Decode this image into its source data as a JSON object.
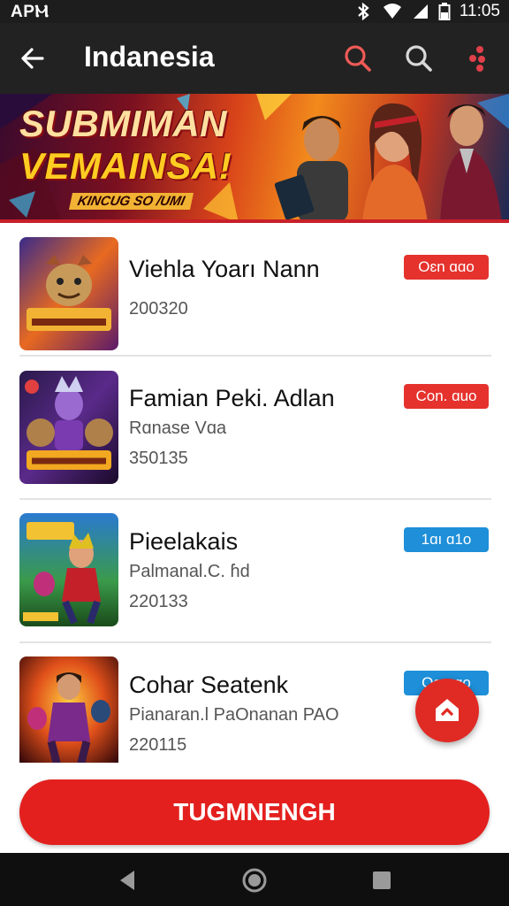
{
  "status_bar": {
    "left_text": "APⲘ",
    "time": "11:05"
  },
  "app_bar": {
    "title": "Indanesia"
  },
  "banner": {
    "title_line1": "SUBMIMAN",
    "title_line2": "VEMAINSA!",
    "subtitle": "KINCUG SO /UMI"
  },
  "items": [
    {
      "title": "Viehla Yoarı Nann",
      "subtitle": "",
      "code": "200320",
      "badge": "Oɛn ɑɑo",
      "badge_color": "#e5322d"
    },
    {
      "title": "Famian Peki. Adlan",
      "subtitle": "Rɑnase Vɑa",
      "code": "350135",
      "badge": "Con. ɑuo",
      "badge_color": "#e5322d"
    },
    {
      "title": "Pieelakais",
      "subtitle": "Palmanal.C. ɦd",
      "code": "220133",
      "badge": "1ɑı ɑ1o",
      "badge_color": "#1e8fd8"
    },
    {
      "title": "Cohar Seatenk",
      "subtitle": "Pianaran.l PaOnanan PAO",
      "code": "220115",
      "badge": "Oɑ.ɑɑo",
      "badge_color": "#1e8fd8"
    }
  ],
  "cta": {
    "label": "TUGMNENGH"
  },
  "icons": {
    "back": "arrow-left-icon",
    "search_red": "search-icon",
    "search_white": "search-icon",
    "more": "more-dots-icon",
    "fab": "home-icon",
    "nav_back": "triangle-back-icon",
    "nav_home": "circle-home-icon",
    "nav_recents": "square-recents-icon"
  },
  "colors": {
    "accent": "#e3201e",
    "badge_red": "#e5322d",
    "badge_blue": "#1e8fd8",
    "app_bar": "#222222"
  }
}
